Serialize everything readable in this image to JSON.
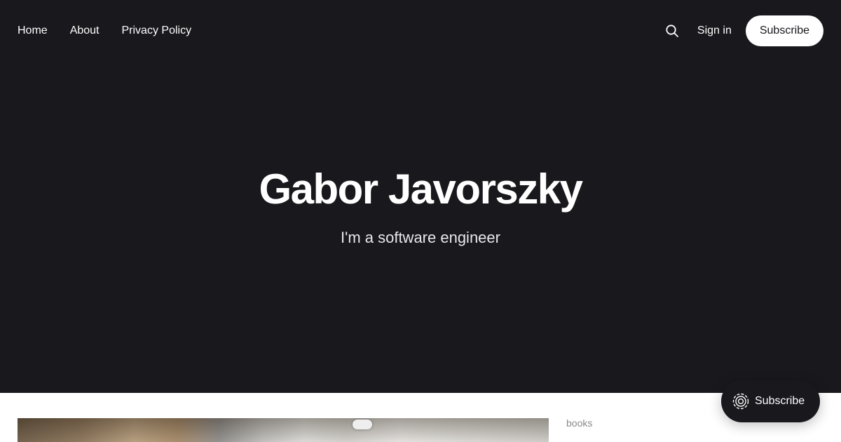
{
  "nav": {
    "links": [
      {
        "label": "Home"
      },
      {
        "label": "About"
      },
      {
        "label": "Privacy Policy"
      }
    ],
    "search_icon": "search-icon",
    "signin_label": "Sign in",
    "subscribe_label": "Subscribe"
  },
  "hero": {
    "title": "Gabor Javorszky",
    "description": "I'm a software engineer"
  },
  "post": {
    "tag": "books"
  },
  "portal": {
    "icon": "portal-icon",
    "label": "Subscribe"
  },
  "colors": {
    "hero_background": "#18181d",
    "accent_button": "#ffffff",
    "tag_text": "#8a8a8f"
  }
}
